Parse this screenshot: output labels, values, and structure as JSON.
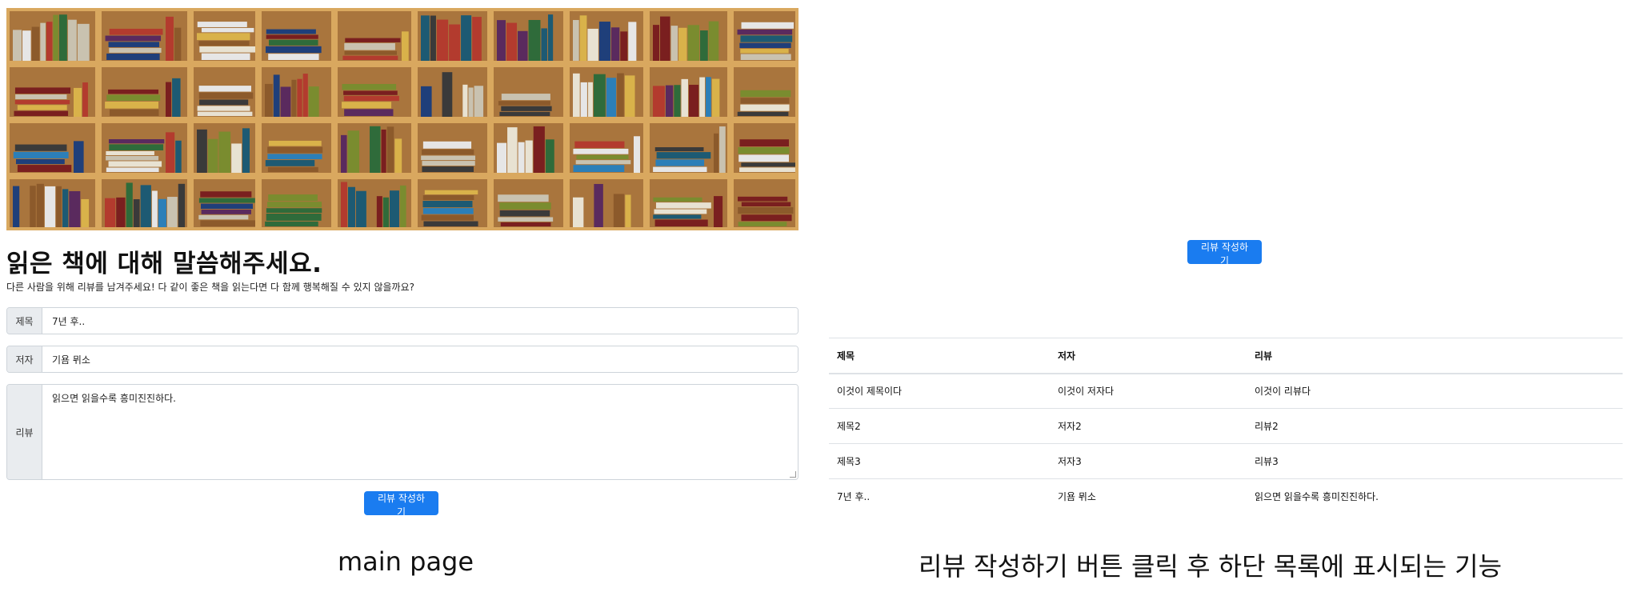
{
  "main_page": {
    "heading": "읽은 책에 대해 말씀해주세요.",
    "subtext": "다른 사람을 위해 리뷰를 남겨주세요! 다 같이 좋은 책을 읽는다면 다 함께 행복해질 수 있지 않을까요?",
    "fields": {
      "title_label": "제목",
      "title_value": "7년 후..",
      "author_label": "저자",
      "author_value": "기욤 뮈소",
      "review_label": "리뷰",
      "review_value": "읽으면 읽을수록 흥미진진하다."
    },
    "submit_button": "리뷰 작성하기",
    "caption": "main page"
  },
  "result_page": {
    "submit_button": "리뷰 작성하기",
    "table": {
      "headers": [
        "제목",
        "저자",
        "리뷰"
      ],
      "rows": [
        [
          "이것이 제목이다",
          "이것이 저자다",
          "이것이 리뷰다"
        ],
        [
          "제목2",
          "저자2",
          "리뷰2"
        ],
        [
          "제목3",
          "저자3",
          "리뷰3"
        ],
        [
          "7년 후..",
          "기욤 뮈소",
          "읽으면 읽을수록 흥미진진하다."
        ]
      ]
    },
    "caption": "리뷰 작성하기 버튼 클릭 후 하단 목록에 표시되는 기능"
  },
  "colors": {
    "primary": "#1a7cf0",
    "shelf_wood": "#d9a85f",
    "shelf_back": "#a9753d"
  }
}
